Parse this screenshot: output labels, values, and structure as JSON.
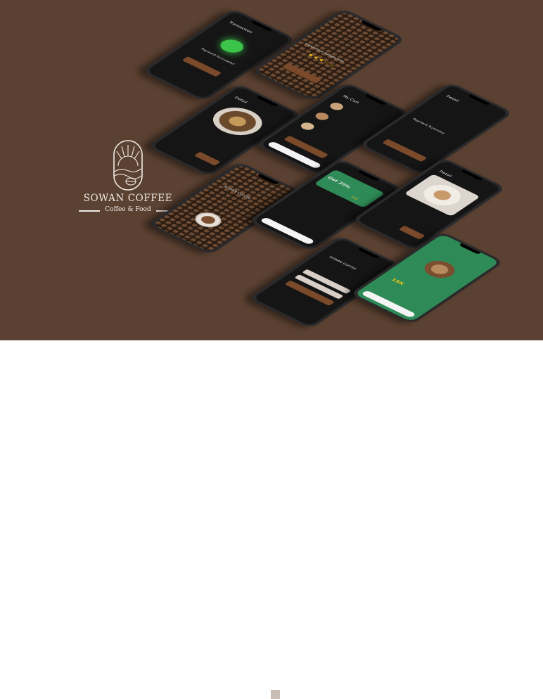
{
  "brand": {
    "name": "SOWAN COFFEE",
    "tagline": "Coffee & Food"
  },
  "phones": {
    "transaction": {
      "title": "Transaction",
      "status": "Payment Successful"
    },
    "rating": {
      "title": "Experience Satisfaction",
      "stars": 3
    },
    "detail_food": {
      "title": "Detail"
    },
    "cart": {
      "title": "My Cart"
    },
    "summary": {
      "title": "Detail",
      "section": "Payment Summary"
    },
    "splash": {
      "brand": "SOWAN COFFEE"
    },
    "home": {
      "promo": "Get 20%",
      "price": "15K"
    },
    "detail_coffee": {
      "title": "Detail"
    },
    "login": {
      "brand": "SOWAN COFFEE"
    },
    "promo": {
      "price": "15K"
    }
  },
  "colors": {
    "background": "#5b4131",
    "accent": "#7b4a2a",
    "green": "#2e8b57"
  }
}
